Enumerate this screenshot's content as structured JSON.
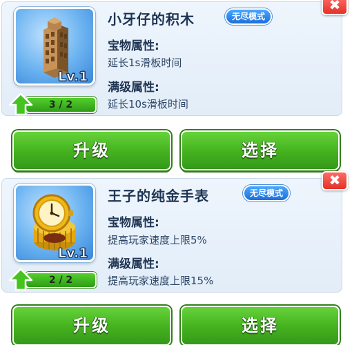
{
  "items": [
    {
      "name": "小牙仔的积木",
      "mode_badge": "无尽模式",
      "level_label": "Lv.1",
      "progress_text": "3 / 2",
      "attr_heading": "宝物属性:",
      "attr_desc": "延长1s滑板时间",
      "max_heading": "满级属性:",
      "max_desc": "延长10s滑板时间",
      "close_label": "✖",
      "upgrade_label": "升级",
      "select_label": "选择"
    },
    {
      "name": "王子的纯金手表",
      "mode_badge": "无尽模式",
      "level_label": "Lv.1",
      "progress_text": "2 / 2",
      "attr_heading": "宝物属性:",
      "attr_desc": "提高玩家速度上限5%",
      "max_heading": "满级属性:",
      "max_desc": "提高玩家速度上限15%",
      "close_label": "✖",
      "upgrade_label": "升级",
      "select_label": "选择"
    }
  ],
  "icons": {
    "item1": "toy-block-tower-icon",
    "item2": "gold-watch-icon",
    "level_up": "green-up-arrow-icon"
  },
  "colors": {
    "button_green": "#46b41f",
    "badge_blue": "#1c6fdc",
    "close_red": "#e33229",
    "card_bg": "#e8f1fb"
  }
}
